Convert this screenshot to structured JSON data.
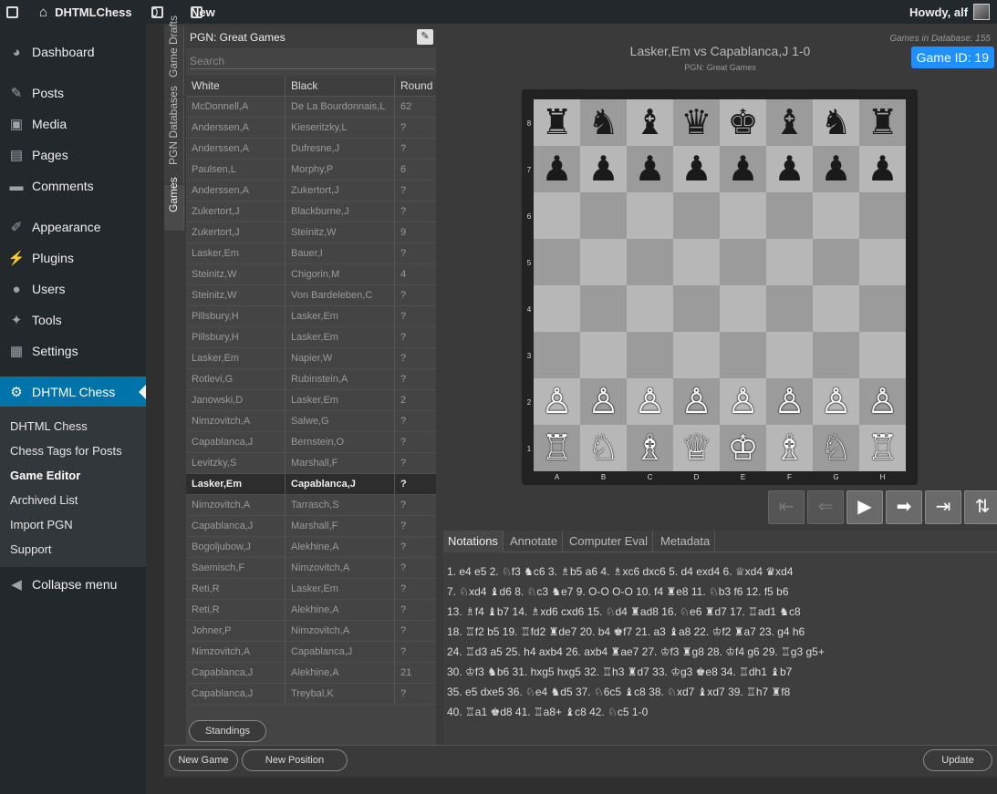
{
  "admin_bar": {
    "site_name": "DHTMLChess",
    "comments_count": "0",
    "new_label": "New",
    "howdy": "Howdy, alf"
  },
  "menu": {
    "dashboard": "Dashboard",
    "posts": "Posts",
    "media": "Media",
    "pages": "Pages",
    "comments": "Comments",
    "appearance": "Appearance",
    "plugins": "Plugins",
    "users": "Users",
    "tools": "Tools",
    "settings": "Settings",
    "dhtml_chess": "DHTML Chess",
    "collapse": "Collapse menu",
    "submenu": [
      "DHTML Chess",
      "Chess Tags for Posts",
      "Game Editor",
      "Archived List",
      "Import PGN",
      "Support"
    ]
  },
  "vtabs": [
    "Game Drafts",
    "PGN Databases",
    "Games"
  ],
  "game_list": {
    "title": "PGN: Great Games",
    "search_placeholder": "Search",
    "columns": [
      "White",
      "Black",
      "Round"
    ],
    "rows": [
      [
        "McDonnell,A",
        "De La Bourdonnais,L",
        "62"
      ],
      [
        "Anderssen,A",
        "Kieseritzky,L",
        "?"
      ],
      [
        "Anderssen,A",
        "Dufresne,J",
        "?"
      ],
      [
        "Paulsen,L",
        "Morphy,P",
        "6"
      ],
      [
        "Anderssen,A",
        "Zukertort,J",
        "?"
      ],
      [
        "Zukertort,J",
        "Blackburne,J",
        "?"
      ],
      [
        "Zukertort,J",
        "Steinitz,W",
        "9"
      ],
      [
        "Lasker,Em",
        "Bauer,I",
        "?"
      ],
      [
        "Steinitz,W",
        "Chigorin,M",
        "4"
      ],
      [
        "Steinitz,W",
        "Von Bardeleben,C",
        "?"
      ],
      [
        "Pillsbury,H",
        "Lasker,Em",
        "?"
      ],
      [
        "Pillsbury,H",
        "Lasker,Em",
        "?"
      ],
      [
        "Lasker,Em",
        "Napier,W",
        "?"
      ],
      [
        "Rotlevi,G",
        "Rubinstein,A",
        "?"
      ],
      [
        "Janowski,D",
        "Lasker,Em",
        "2"
      ],
      [
        "Nimzovitch,A",
        "Salwe,G",
        "?"
      ],
      [
        "Capablanca,J",
        "Bernstein,O",
        "?"
      ],
      [
        "Levitzky,S",
        "Marshall,F",
        "?"
      ],
      [
        "Lasker,Em",
        "Capablanca,J",
        "?"
      ],
      [
        "Nimzovitch,A",
        "Tarrasch,S",
        "?"
      ],
      [
        "Capablanca,J",
        "Marshall,F",
        "?"
      ],
      [
        "Bogoljubow,J",
        "Alekhine,A",
        "?"
      ],
      [
        "Saemisch,F",
        "Nimzovitch,A",
        "?"
      ],
      [
        "Reti,R",
        "Lasker,Em",
        "?"
      ],
      [
        "Reti,R",
        "Alekhine,A",
        "?"
      ],
      [
        "Johner,P",
        "Nimzovitch,A",
        "?"
      ],
      [
        "Nimzovitch,A",
        "Capablanca,J",
        "?"
      ],
      [
        "Capablanca,J",
        "Alekhine,A",
        "21"
      ],
      [
        "Capablanca,J",
        "Treybal,K",
        "?"
      ]
    ],
    "selected_index": 18,
    "standings_label": "Standings"
  },
  "board": {
    "title": "Lasker,Em vs Capablanca,J 1-0",
    "subtitle": "PGN: Great Games",
    "db_count": "Games in Database: 155",
    "game_id": "Game ID: 19",
    "ranks": [
      "8",
      "7",
      "6",
      "5",
      "4",
      "3",
      "2",
      "1"
    ],
    "files": [
      "A",
      "B",
      "C",
      "D",
      "E",
      "F",
      "G",
      "H"
    ],
    "position": [
      "rnbqkbnr",
      "pppppppp",
      "........",
      "........",
      "........",
      "........",
      "PPPPPPPP",
      "RNBQKBNR"
    ]
  },
  "notation_tabs": [
    "Notations",
    "Annotate",
    "Computer Eval",
    "Metadata"
  ],
  "moves": [
    "1. e4 e5 2. ♘f3 ♞c6 3. ♗b5 a6 4. ♗xc6 dxc6 5. d4 exd4 6. ♕xd4 ♛xd4",
    "7. ♘xd4 ♝d6 8. ♘c3 ♞e7 9. O-O O-O 10. f4 ♜e8 11. ♘b3 f6 12. f5 b6",
    "13. ♗f4 ♝b7 14. ♗xd6 cxd6 15. ♘d4 ♜ad8 16. ♘e6 ♜d7 17. ♖ad1 ♞c8",
    "18. ♖f2 b5 19. ♖fd2 ♜de7 20. b4 ♚f7 21. a3 ♝a8 22. ♔f2 ♜a7 23. g4 h6",
    "24. ♖d3 a5 25. h4 axb4 26. axb4 ♜ae7 27. ♔f3 ♜g8 28. ♔f4 g6 29. ♖g3 g5+",
    "30. ♔f3 ♞b6 31. hxg5 hxg5 32. ♖h3 ♜d7 33. ♔g3 ♚e8 34. ♖dh1 ♝b7",
    "35. e5 dxe5 36. ♘e4 ♞d5 37. ♘6c5 ♝c8 38. ♘xd7 ♝xd7 39. ♖h7 ♜f8",
    "40. ♖a1 ♚d8 41. ♖a8+ ♝c8 42. ♘c5 1-0"
  ],
  "buttons": {
    "new_game": "New Game",
    "new_position": "New Position",
    "update": "Update"
  }
}
